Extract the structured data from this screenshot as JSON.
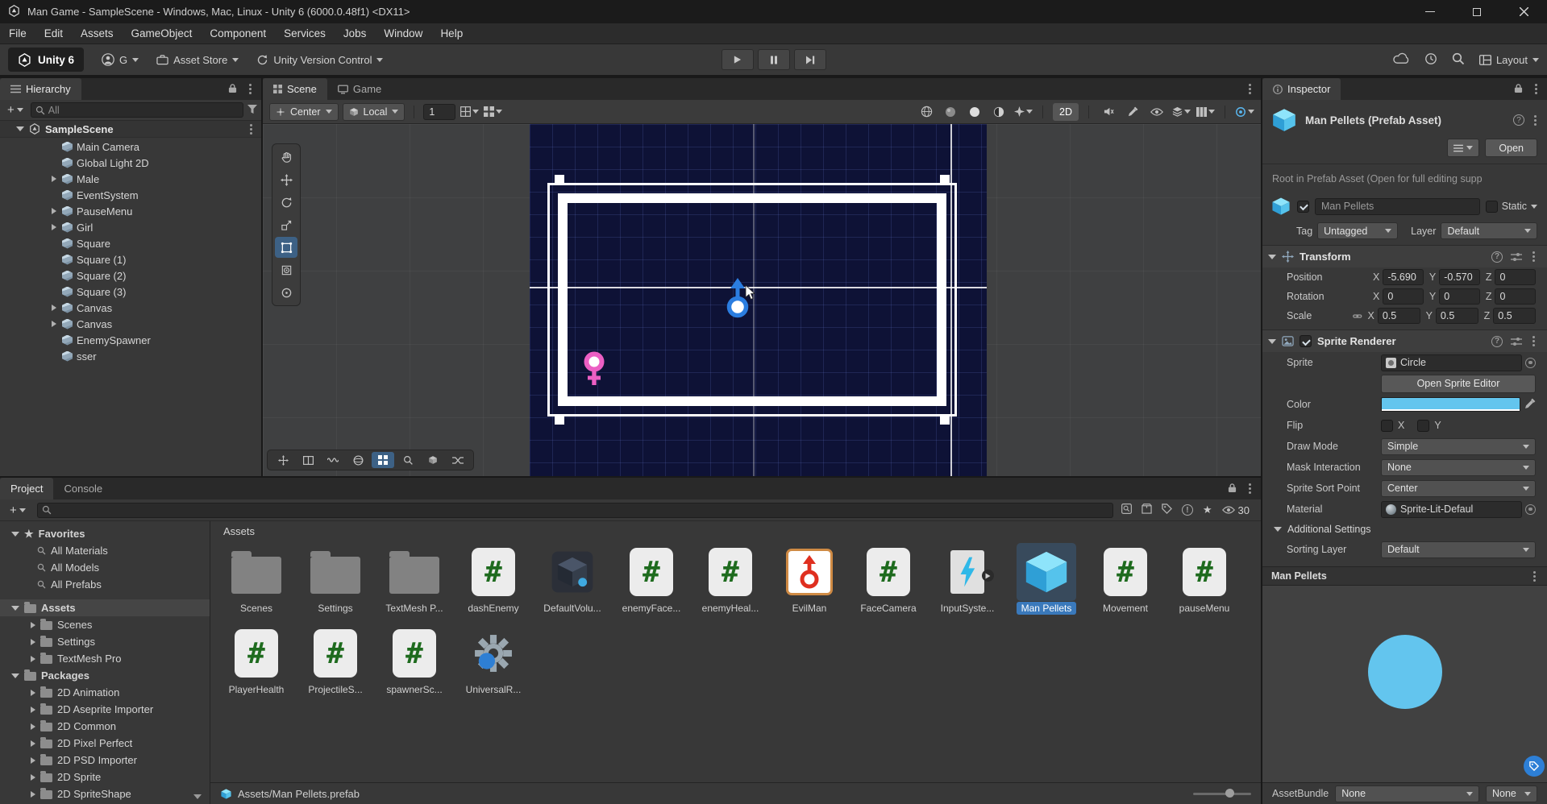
{
  "window": {
    "title": "Man Game - SampleScene - Windows, Mac, Linux - Unity 6 (6000.0.48f1) <DX11>"
  },
  "menu": {
    "items": [
      "File",
      "Edit",
      "Assets",
      "GameObject",
      "Component",
      "Services",
      "Jobs",
      "Window",
      "Help"
    ]
  },
  "toolbar": {
    "unity_version": "Unity 6",
    "account_initial": "G",
    "asset_store": "Asset Store",
    "version_control": "Unity Version Control",
    "layout": "Layout"
  },
  "hierarchy": {
    "tab": "Hierarchy",
    "search_placeholder": "All",
    "scene_name": "SampleScene",
    "items": [
      {
        "label": "Main Camera",
        "expand": false
      },
      {
        "label": "Global Light 2D",
        "expand": false
      },
      {
        "label": "Male",
        "expand": true
      },
      {
        "label": "EventSystem",
        "expand": false
      },
      {
        "label": "PauseMenu",
        "expand": true
      },
      {
        "label": "Girl",
        "expand": true
      },
      {
        "label": "Square",
        "expand": false
      },
      {
        "label": "Square (1)",
        "expand": false
      },
      {
        "label": "Square (2)",
        "expand": false
      },
      {
        "label": "Square (3)",
        "expand": false
      },
      {
        "label": "Canvas",
        "expand": true
      },
      {
        "label": "Canvas",
        "expand": true
      },
      {
        "label": "EnemySpawner",
        "expand": false
      },
      {
        "label": "sser",
        "expand": false
      }
    ]
  },
  "scene": {
    "tab_scene": "Scene",
    "tab_game": "Game",
    "pivot": "Center",
    "orientation": "Local",
    "grid_size": "1",
    "mode_2d": "2D"
  },
  "project": {
    "tab_project": "Project",
    "tab_console": "Console",
    "eye_count": "30",
    "favorites_label": "Favorites",
    "favorites": [
      {
        "label": "All Materials"
      },
      {
        "label": "All Models"
      },
      {
        "label": "All Prefabs"
      }
    ],
    "assets_label": "Assets",
    "asset_folders": [
      {
        "label": "Scenes"
      },
      {
        "label": "Settings"
      },
      {
        "label": "TextMesh Pro"
      }
    ],
    "packages_label": "Packages",
    "package_folders": [
      {
        "label": "2D Animation"
      },
      {
        "label": "2D Aseprite Importer"
      },
      {
        "label": "2D Common"
      },
      {
        "label": "2D Pixel Perfect"
      },
      {
        "label": "2D PSD Importer"
      },
      {
        "label": "2D Sprite"
      },
      {
        "label": "2D SpriteShape"
      }
    ],
    "content_header": "Assets",
    "assets": [
      {
        "label": "Scenes"
      },
      {
        "label": "Settings"
      },
      {
        "label": "TextMesh P..."
      },
      {
        "label": "dashEnemy"
      },
      {
        "label": "DefaultVolu..."
      },
      {
        "label": "enemyFace..."
      },
      {
        "label": "enemyHeal..."
      },
      {
        "label": "EvilMan"
      },
      {
        "label": "FaceCamera"
      },
      {
        "label": "InputSyste..."
      },
      {
        "label": "Man Pellets"
      },
      {
        "label": "Movement"
      },
      {
        "label": "pauseMenu"
      },
      {
        "label": "PlayerHealth"
      },
      {
        "label": "ProjectileS..."
      },
      {
        "label": "spawnerSc..."
      },
      {
        "label": "UniversalR..."
      }
    ],
    "breadcrumb": "Assets/Man Pellets.prefab"
  },
  "inspector": {
    "tab": "Inspector",
    "prefab_title": "Man Pellets (Prefab Asset)",
    "open_button": "Open",
    "note": "Root in Prefab Asset (Open for full editing supp",
    "name_field": "Man Pellets",
    "static_label": "Static",
    "tag_label": "Tag",
    "tag_value": "Untagged",
    "layer_label": "Layer",
    "layer_value": "Default",
    "axes": {
      "x": "X",
      "y": "Y",
      "z": "Z"
    },
    "transform": {
      "title": "Transform",
      "rows": [
        {
          "label": "Position",
          "x": "-5.690",
          "y": "-0.570",
          "z": "0"
        },
        {
          "label": "Rotation",
          "x": "0",
          "y": "0",
          "z": "0"
        },
        {
          "label": "Scale",
          "x": "0.5",
          "y": "0.5",
          "z": "0.5"
        }
      ]
    },
    "sprite_renderer": {
      "title": "Sprite Renderer",
      "sprite_label": "Sprite",
      "sprite_value": "Circle",
      "open_sprite_editor": "Open Sprite Editor",
      "color_label": "Color",
      "flip_label": "Flip",
      "flip_x": "X",
      "flip_y": "Y",
      "draw_mode_label": "Draw Mode",
      "draw_mode_value": "Simple",
      "mask_label": "Mask Interaction",
      "mask_value": "None",
      "sort_point_label": "Sprite Sort Point",
      "sort_point_value": "Center",
      "material_label": "Material",
      "material_value": "Sprite-Lit-Defaul",
      "additional_label": "Additional Settings",
      "sorting_layer_label": "Sorting Layer",
      "sorting_layer_value": "Default"
    },
    "preview_title": "Man Pellets",
    "assetbundle_label": "AssetBundle",
    "assetbundle_value1": "None",
    "assetbundle_value2": "None"
  },
  "colors": {
    "pellet_blue": "#63c5ee",
    "male_blue": "#2b7de0",
    "female_pink": "#ec5fc4",
    "evil_red": "#df2f1f",
    "selection_blue": "#3a79bb"
  }
}
